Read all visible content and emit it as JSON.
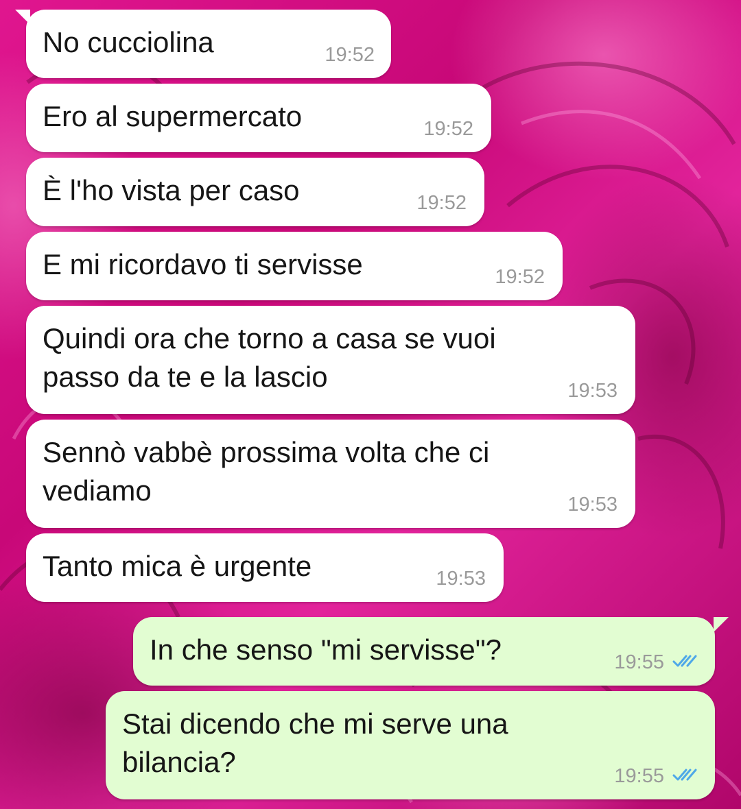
{
  "messages": [
    {
      "direction": "incoming",
      "text": "No cucciolina",
      "time": "19:52"
    },
    {
      "direction": "incoming",
      "text": "Ero al supermercato",
      "time": "19:52"
    },
    {
      "direction": "incoming",
      "text": "È l'ho vista per caso",
      "time": "19:52"
    },
    {
      "direction": "incoming",
      "text": "E mi ricordavo ti servisse",
      "time": "19:52"
    },
    {
      "direction": "incoming",
      "lines": [
        "Quindi ora che torno a casa se vuoi",
        "passo da te e la lascio"
      ],
      "time": "19:53"
    },
    {
      "direction": "incoming",
      "lines": [
        "Sennò vabbè prossima volta che ci",
        "vediamo"
      ],
      "time": "19:53"
    },
    {
      "direction": "incoming",
      "text": "Tanto mica è urgente",
      "time": "19:53"
    },
    {
      "direction": "outgoing",
      "text": "In che senso \"mi servisse\"?",
      "time": "19:55",
      "status": "read"
    },
    {
      "direction": "outgoing",
      "lines": [
        "Stai dicendo che mi serve una",
        "bilancia?"
      ],
      "time": "19:55",
      "status": "read"
    }
  ],
  "colors": {
    "incoming_bubble": "#ffffff",
    "outgoing_bubble": "#e2fdd2",
    "read_ticks": "#4fa8e8",
    "wallpaper": "#d8127f"
  },
  "icons": {
    "read_status": "double-check-icon",
    "wallpaper": "pink-roses-wallpaper"
  }
}
